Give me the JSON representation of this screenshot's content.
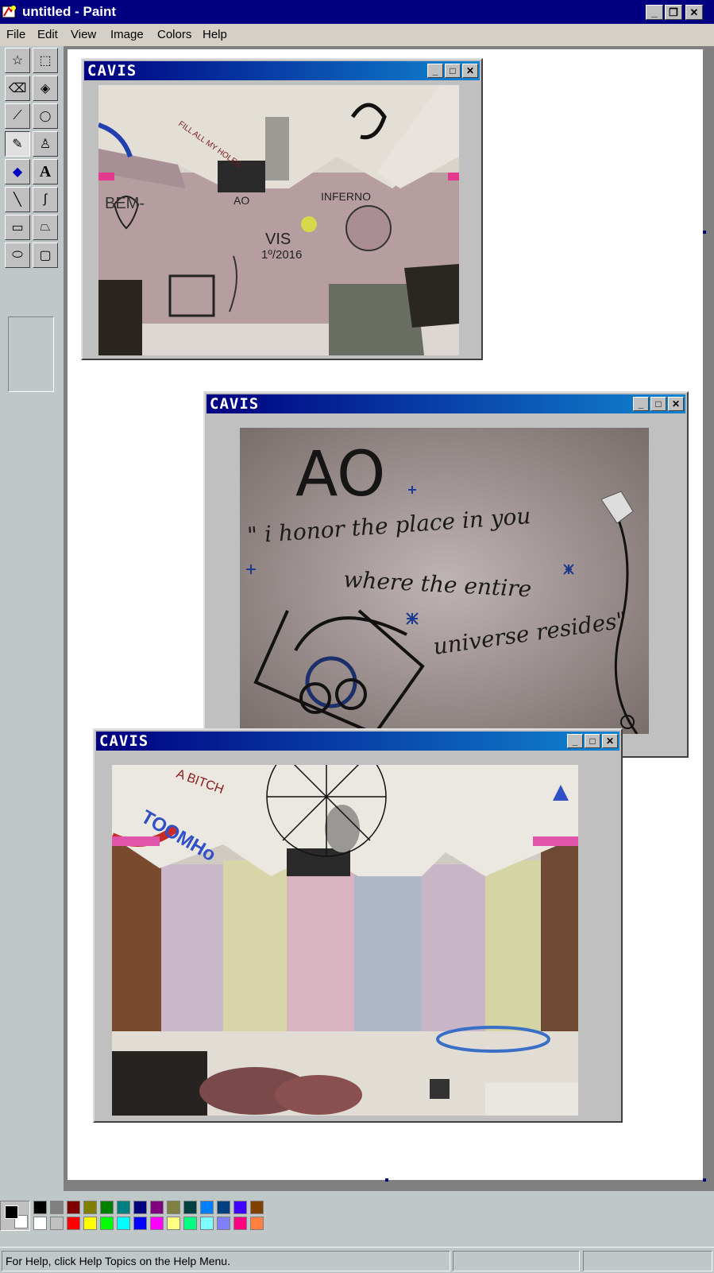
{
  "window": {
    "title": "untitled - Paint",
    "controls": {
      "minimize": "_",
      "restore": "❐",
      "close": "✕"
    }
  },
  "menu": {
    "items": [
      {
        "label": "File"
      },
      {
        "label": "Edit"
      },
      {
        "label": "View"
      },
      {
        "label": "Image"
      },
      {
        "label": "Colors"
      },
      {
        "label": "Help"
      }
    ]
  },
  "tools": [
    {
      "icon": "free-select-icon",
      "glyph": "☆"
    },
    {
      "icon": "rect-select-icon",
      "glyph": "⬚"
    },
    {
      "icon": "eraser-icon",
      "glyph": "⌫"
    },
    {
      "icon": "fill-bucket-icon",
      "glyph": "◈"
    },
    {
      "icon": "color-picker-icon",
      "glyph": "⟋"
    },
    {
      "icon": "magnifier-icon",
      "glyph": "🔍"
    },
    {
      "icon": "pencil-icon",
      "glyph": "✎"
    },
    {
      "icon": "brush-icon",
      "glyph": "♙"
    },
    {
      "icon": "airbrush-icon",
      "glyph": "◆"
    },
    {
      "icon": "text-icon",
      "glyph": "A"
    },
    {
      "icon": "line-icon",
      "glyph": "╲"
    },
    {
      "icon": "curve-icon",
      "glyph": "∫"
    },
    {
      "icon": "rectangle-icon",
      "glyph": "▭"
    },
    {
      "icon": "polygon-icon",
      "glyph": "⏢"
    },
    {
      "icon": "ellipse-icon",
      "glyph": "⬭"
    },
    {
      "icon": "rounded-rect-icon",
      "glyph": "▢"
    }
  ],
  "subwindows": [
    {
      "title": "CAVIS",
      "photo": "graffiti room with ceiling lamp and lounge chair"
    },
    {
      "title": "CAVIS",
      "photo": "graffiti wall text close-up"
    },
    {
      "title": "CAVIS",
      "photo": "pastel striped room with umbrella lamp"
    }
  ],
  "graffiti": {
    "big": "AO",
    "line1": "\" i honor the place in you",
    "line2": "where the entire",
    "line3": "universe resides\""
  },
  "wall1": {
    "t1": "BEM-",
    "t2": "VIS",
    "t3": "1º/2016",
    "t4": "INFERNO",
    "t5": "AO",
    "t6": "FILL ALL MY HOLES"
  },
  "wall3": {
    "t1": "A BITCH",
    "t2": "TOOMHo"
  },
  "palette": {
    "foreground": "#000000",
    "background": "#ffffff",
    "row1": [
      "#000000",
      "#808080",
      "#800000",
      "#808000",
      "#008000",
      "#008080",
      "#000080",
      "#800080",
      "#808040",
      "#004040",
      "#0080ff",
      "#004080",
      "#4000ff",
      "#804000"
    ],
    "row2": [
      "#ffffff",
      "#c0c0c0",
      "#ff0000",
      "#ffff00",
      "#00ff00",
      "#00ffff",
      "#0000ff",
      "#ff00ff",
      "#ffff80",
      "#00ff80",
      "#80ffff",
      "#8080ff",
      "#ff0080",
      "#ff8040"
    ]
  },
  "status": {
    "help": "For Help, click Help Topics on the Help Menu.",
    "cell2": "",
    "cell3": ""
  }
}
